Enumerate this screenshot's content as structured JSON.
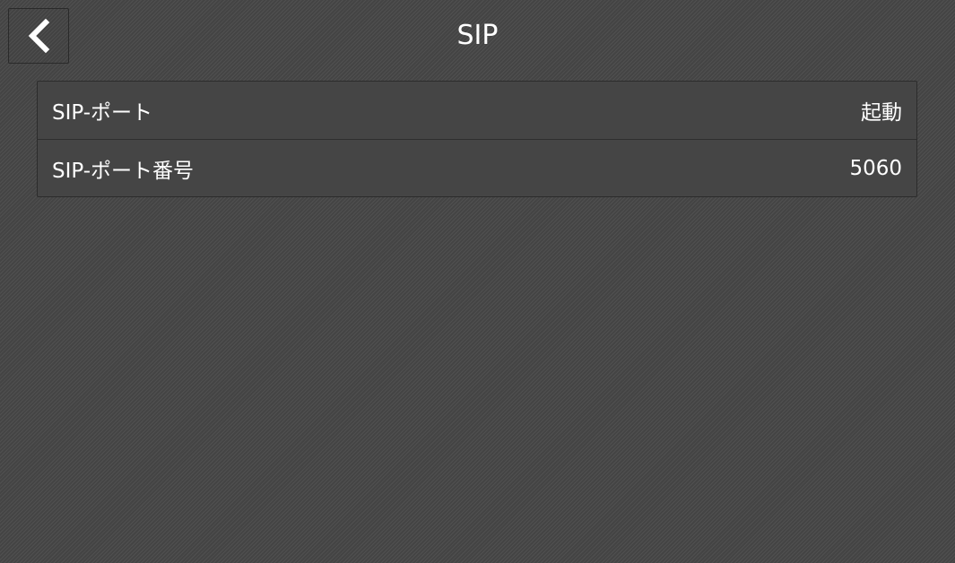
{
  "header": {
    "title": "SIP",
    "back_icon": "chevron-left-icon"
  },
  "settings": {
    "items": [
      {
        "label": "SIP-ポート",
        "value": "起動"
      },
      {
        "label": "SIP-ポート番号",
        "value": "5060"
      }
    ]
  }
}
